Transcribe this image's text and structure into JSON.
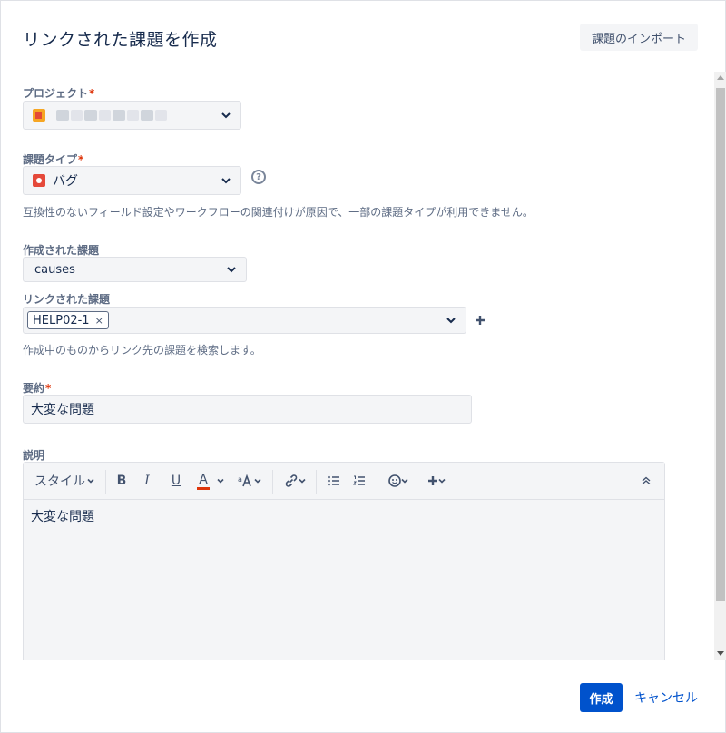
{
  "dialog": {
    "title": "リンクされた課題を作成",
    "import_label": "課題のインポート"
  },
  "fields": {
    "project": {
      "label": "プロジェクト",
      "required": "*"
    },
    "issue_type": {
      "label": "課題タイプ",
      "required": "*",
      "value": "バグ",
      "help_icon": "?",
      "note": "互換性のないフィールド設定やワークフローの関連付けが原因で、一部の課題タイプが利用できません。"
    },
    "created_issue": {
      "label": "作成された課題",
      "value": "causes"
    },
    "linked_issue": {
      "label": "リンクされた課題",
      "tag": "HELP02-1",
      "tag_remove": "×",
      "note": "作成中のものからリンク先の課題を検索します。"
    },
    "summary": {
      "label": "要約",
      "required": "*",
      "value": "大変な問題"
    },
    "description": {
      "label": "説明",
      "body": "大変な問題",
      "toolbar": {
        "style": "スタイル",
        "bold": "B",
        "italic": "I",
        "underline": "U",
        "color": "A"
      }
    }
  },
  "footer": {
    "create_label": "作成",
    "cancel_label": "キャンセル"
  },
  "colors": {
    "primary": "#0052cc",
    "required": "#de350b",
    "bug": "#e5493a",
    "text_color_bar": "#de350b"
  }
}
